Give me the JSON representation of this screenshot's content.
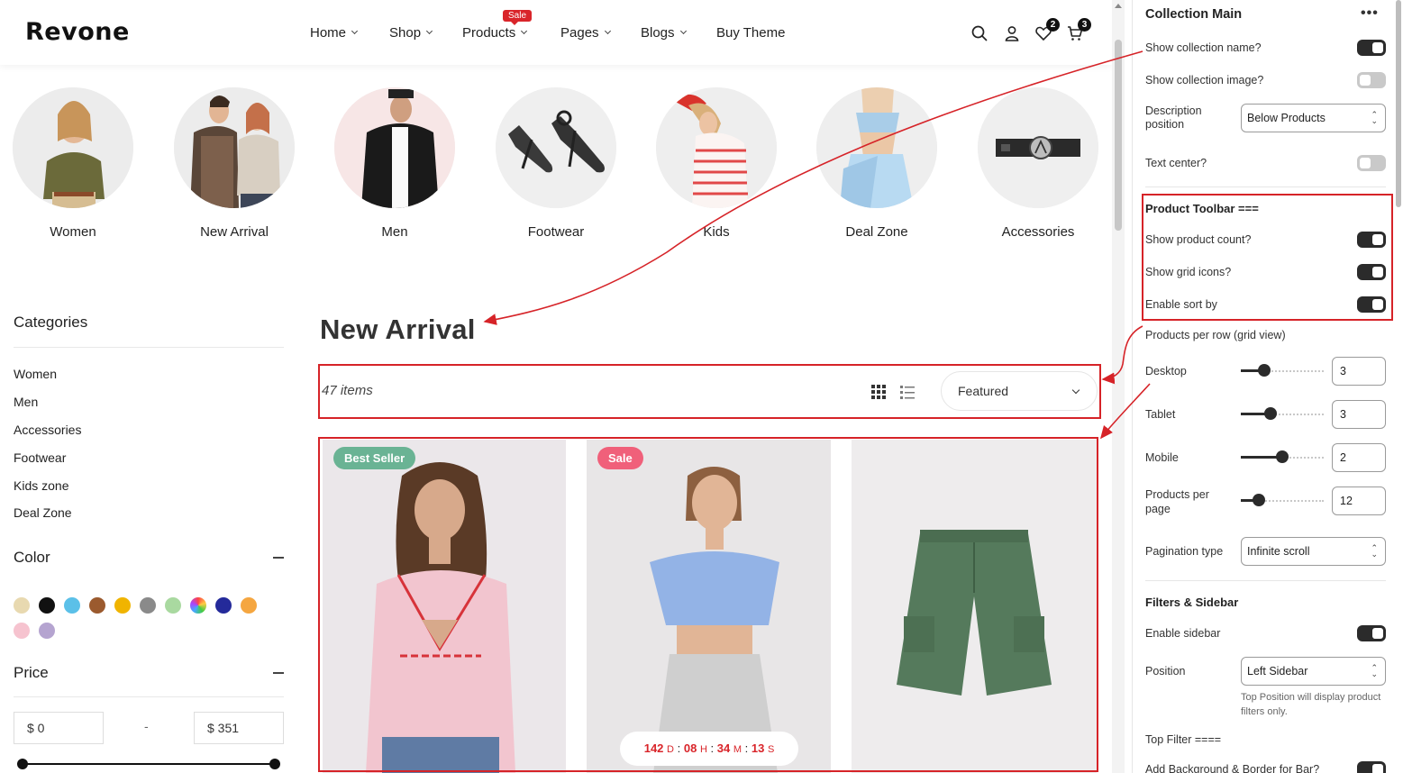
{
  "header": {
    "logo": "Revone",
    "nav": [
      {
        "label": "Home"
      },
      {
        "label": "Shop"
      },
      {
        "label": "Products"
      },
      {
        "label": "Pages"
      },
      {
        "label": "Blogs"
      },
      {
        "label": "Buy Theme"
      }
    ],
    "sale_badge": "Sale",
    "wishlist_count": "2",
    "cart_count": "3",
    "icons": [
      "search-icon",
      "user-icon",
      "heart-icon",
      "cart-icon"
    ]
  },
  "collections": [
    "Women",
    "New Arrival",
    "Men",
    "Footwear",
    "Kids",
    "Deal Zone",
    "Accessories"
  ],
  "sidebar": {
    "categories_title": "Categories",
    "categories": [
      "Women",
      "Men",
      "Accessories",
      "Footwear",
      "Kids zone",
      "Deal Zone"
    ],
    "color_title": "Color",
    "colors": [
      "#e8d9b0",
      "#111111",
      "#5bc0e8",
      "#9b5a2e",
      "#f0b400",
      "#8a8a8a",
      "#a9d9a0",
      "multicolor",
      "#242a9a",
      "#f5a640",
      "#f6c3cf",
      "#b5a4d0"
    ],
    "price_title": "Price",
    "price_min": "$ 0",
    "price_sep": "-",
    "price_max": "$ 351"
  },
  "main": {
    "title": "New Arrival",
    "item_count": "47 items",
    "sort_value": "Featured",
    "products": [
      {
        "tag": "Best Seller",
        "tag_color": "#6ab394"
      },
      {
        "tag": "Sale",
        "tag_color": "#f0607a"
      },
      {
        "tag": ""
      }
    ],
    "timer": {
      "days": "142",
      "d": "D",
      "hours": "08",
      "h": "H",
      "minutes": "34",
      "m": "M",
      "seconds": "13",
      "s": "S"
    }
  },
  "editor": {
    "section_title": "Collection Main",
    "show_collection_name": "Show collection name?",
    "show_collection_image": "Show collection image?",
    "description_position_label": "Description position",
    "description_position_value": "Below Products",
    "text_center": "Text center?",
    "toolbar_title": "Product Toolbar ===",
    "show_product_count": "Show product count?",
    "show_grid_icons": "Show grid icons?",
    "enable_sort_by": "Enable sort by",
    "per_row_title": "Products per row (grid view)",
    "desktop_label": "Desktop",
    "desktop_value": "3",
    "tablet_label": "Tablet",
    "tablet_value": "3",
    "mobile_label": "Mobile",
    "mobile_value": "2",
    "per_page_label": "Products per page",
    "per_page_value": "12",
    "pagination_label": "Pagination type",
    "pagination_value": "Infinite scroll",
    "filters_title": "Filters & Sidebar",
    "enable_sidebar": "Enable sidebar",
    "position_label": "Position",
    "position_value": "Left Sidebar",
    "position_hint": "Top Position will display product filters only.",
    "top_filter": "Top Filter ====",
    "add_background": "Add Background & Border for Bar?",
    "toggles": {
      "show_collection_name": true,
      "show_collection_image": false,
      "text_center": false,
      "show_product_count": true,
      "show_grid_icons": true,
      "enable_sort_by": true,
      "enable_sidebar": true,
      "add_background": true
    },
    "ranges": {
      "desktop": 0.28,
      "tablet": 0.36,
      "mobile": 0.5,
      "per_page": 0.22
    }
  }
}
